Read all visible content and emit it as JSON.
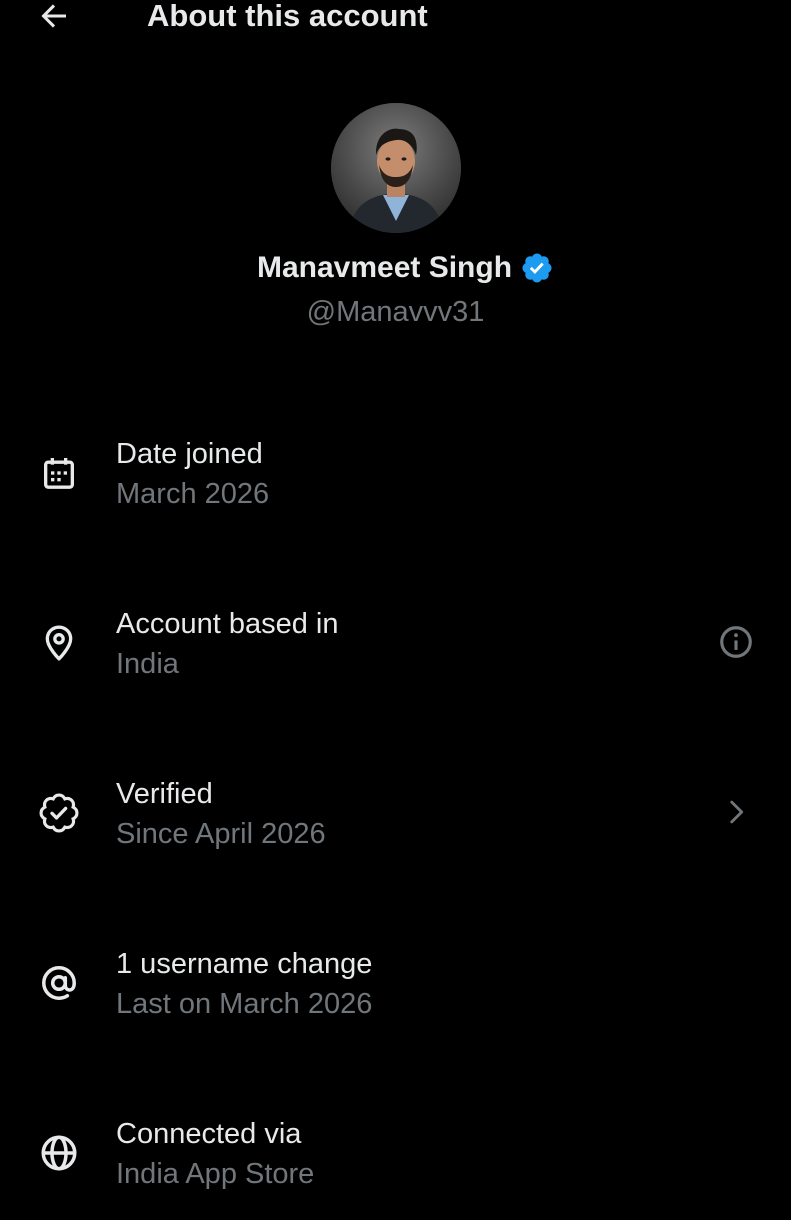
{
  "header": {
    "title": "About this account",
    "back_icon": "arrow-left-icon"
  },
  "profile": {
    "display_name": "Manavmeet Singh",
    "handle": "@Manavvv31",
    "verified": true,
    "badge_color": "#1d9bf0"
  },
  "colors": {
    "background": "#000000",
    "primary_text": "#e7e9ea",
    "secondary_text": "#71767b",
    "accent": "#1d9bf0"
  },
  "info_rows": [
    {
      "icon": "calendar-icon",
      "title": "Date joined",
      "subtitle": "March 2026",
      "action_icon": ""
    },
    {
      "icon": "location-pin-icon",
      "title": "Account based in",
      "subtitle": "India",
      "action_icon": "info-icon"
    },
    {
      "icon": "verified-badge-outline-icon",
      "title": "Verified",
      "subtitle": "Since April 2026",
      "action_icon": "chevron-right-icon"
    },
    {
      "icon": "at-sign-icon",
      "title": "1 username change",
      "subtitle": "Last on March 2026",
      "action_icon": ""
    },
    {
      "icon": "globe-icon",
      "title": "Connected via",
      "subtitle": "India App Store",
      "action_icon": ""
    }
  ]
}
